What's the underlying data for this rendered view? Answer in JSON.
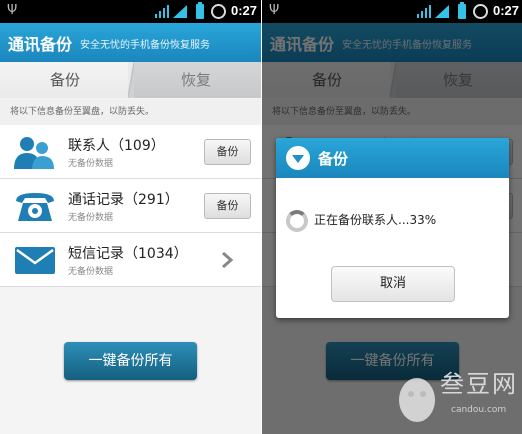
{
  "status": {
    "time": "0:27"
  },
  "header": {
    "title": "通讯备份",
    "subtitle": "安全无忧的手机备份恢复服务"
  },
  "tabs": [
    {
      "label": "备份"
    },
    {
      "label": "恢复"
    }
  ],
  "hint": "将以下信息备份至翼盘，以防丢失。",
  "items": [
    {
      "icon": "contacts-icon",
      "title": "联系人（109）",
      "subtitle": "无备份数据",
      "button": "备份"
    },
    {
      "icon": "phone-icon",
      "title": "通话记录（291）",
      "subtitle": "无备份数据",
      "button": "备份"
    },
    {
      "icon": "envelope-icon",
      "title": "短信记录（1034）",
      "subtitle": "无备份数据"
    }
  ],
  "backup_all": "一键备份所有",
  "dialog": {
    "title": "备份",
    "message": "正在备份联系人...33%",
    "cancel": "取消",
    "progress_percent": 33
  },
  "watermark": {
    "text": "叁豆网",
    "url": "candou.com"
  },
  "colors": {
    "accent": "#1f95c9",
    "primary_button": "#1a6f95"
  }
}
